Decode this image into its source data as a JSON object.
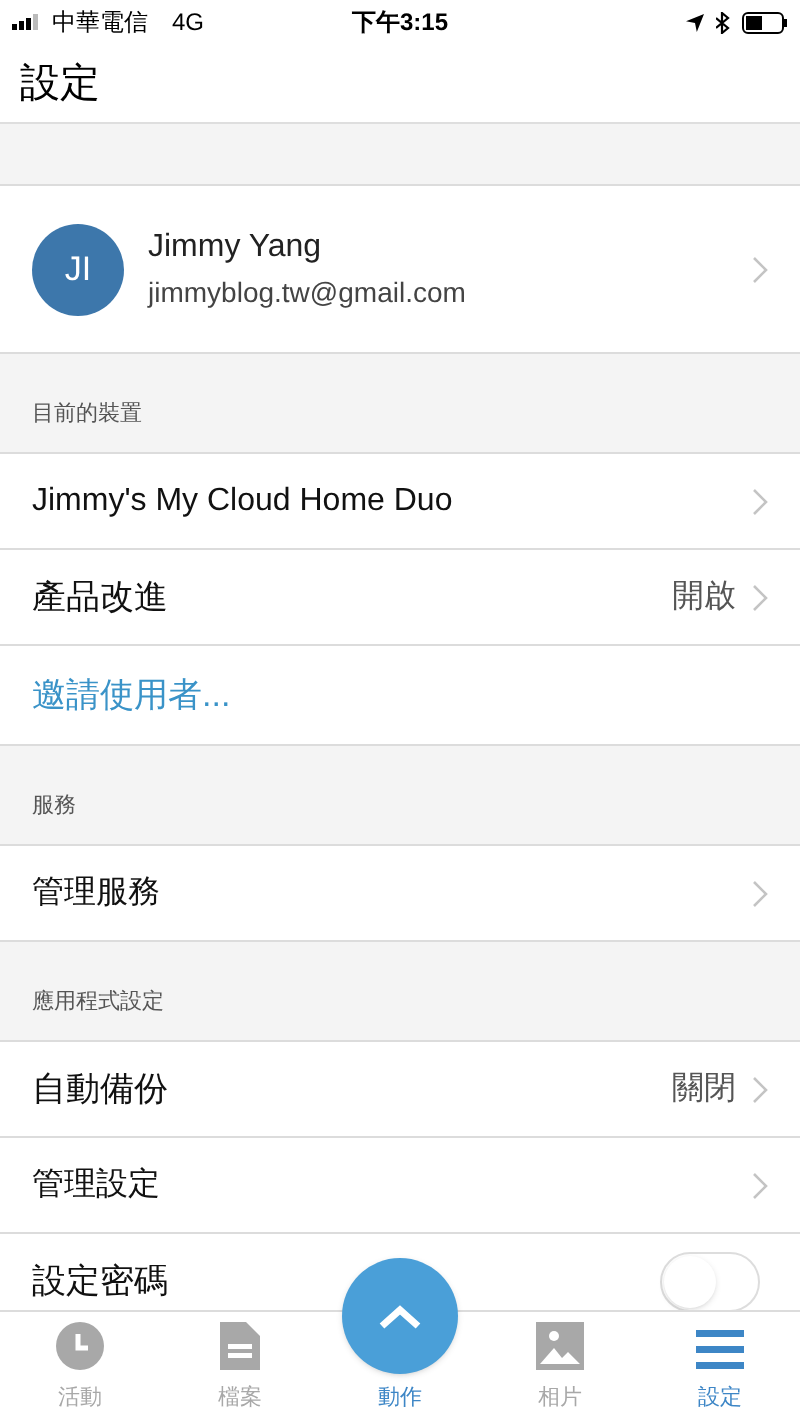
{
  "status_bar": {
    "carrier": "中華電信",
    "network": "4G",
    "time": "下午3:15"
  },
  "header": {
    "title": "設定"
  },
  "profile": {
    "initials": "JI",
    "name": "Jimmy Yang",
    "email": "jimmyblog.tw@gmail.com"
  },
  "sections": [
    {
      "header": "目前的裝置",
      "rows": [
        {
          "kind": "link",
          "label": "Jimmy's My Cloud Home Duo"
        },
        {
          "kind": "value",
          "label": "產品改進",
          "value": "開啟"
        },
        {
          "kind": "action",
          "label": "邀請使用者..."
        }
      ]
    },
    {
      "header": "服務",
      "rows": [
        {
          "kind": "link",
          "label": "管理服務"
        }
      ]
    },
    {
      "header": "應用程式設定",
      "rows": [
        {
          "kind": "value",
          "label": "自動備份",
          "value": "關閉"
        },
        {
          "kind": "link",
          "label": "管理設定"
        },
        {
          "kind": "toggle",
          "label": "設定密碼",
          "on": false
        }
      ]
    }
  ],
  "tab_bar": [
    {
      "kind": "clock",
      "label": "活動",
      "selected": false
    },
    {
      "kind": "file",
      "label": "檔案",
      "selected": false
    },
    {
      "kind": "action",
      "label": "動作",
      "selected": false
    },
    {
      "kind": "photo",
      "label": "相片",
      "selected": false
    },
    {
      "kind": "menu",
      "label": "設定",
      "selected": true
    }
  ]
}
